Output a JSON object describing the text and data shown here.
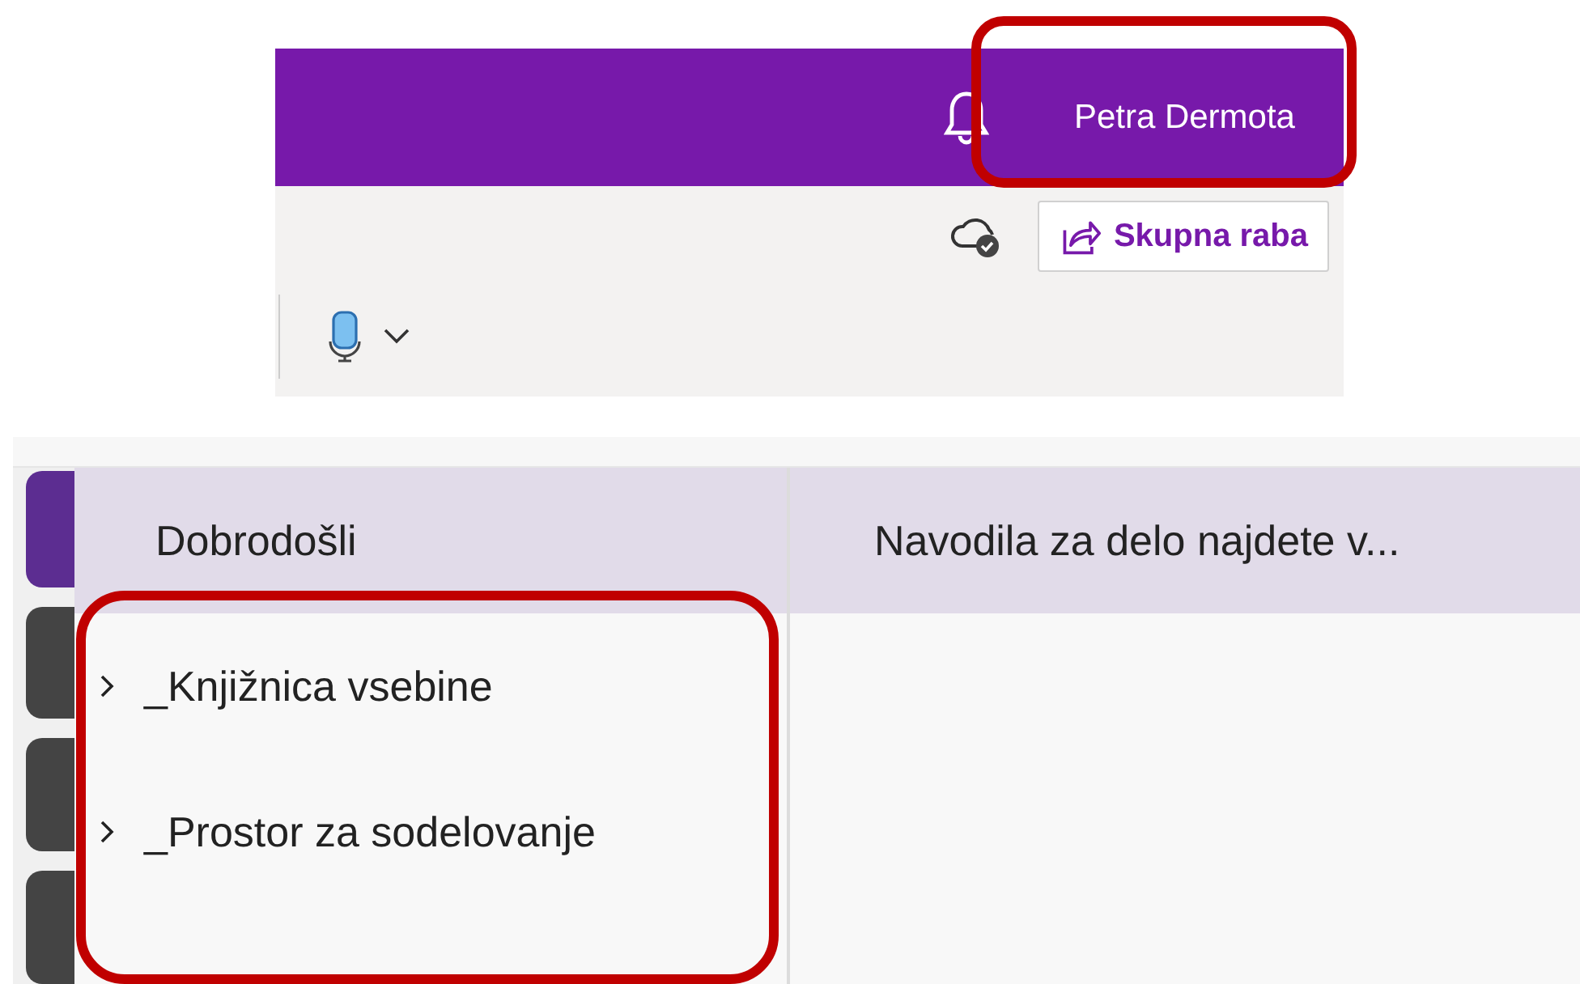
{
  "header": {
    "user_name": "Petra Dermota",
    "highlighted": true
  },
  "toolbar": {
    "share_button": "Skupna raba"
  },
  "notebook": {
    "tabs": [
      {
        "selected": true
      },
      {
        "selected": false
      },
      {
        "selected": false
      },
      {
        "selected": false
      }
    ],
    "section_header": "Dobrodošli",
    "page_header": "Navodila za delo najdete v...",
    "sections": [
      {
        "label": "_Knjižnica vsebine",
        "expanded": false
      },
      {
        "label": "_Prostor za sodelovanje",
        "expanded": false
      }
    ],
    "sections_highlighted": true
  }
}
